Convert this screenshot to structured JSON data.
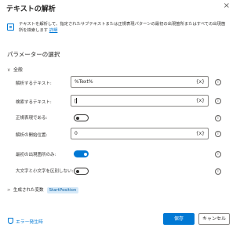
{
  "dialog": {
    "title": "テキストの解析",
    "close_icon": "×"
  },
  "description": {
    "text": "テキストを解析して、指定されたサブテキストまたは正規表現パターンの最初の出現箇所またはすべての出現箇所を検索します",
    "link": "詳細"
  },
  "section_title": "パラメーターの選択",
  "group": {
    "chevron": "∨",
    "label": "全般"
  },
  "fields": {
    "text_to_parse": {
      "label": "解析するテキスト:",
      "value": "%Text%",
      "var_button": "{x}"
    },
    "text_to_find": {
      "label": "検索するテキスト:",
      "value": "[",
      "var_button": "{x}"
    },
    "is_regex": {
      "label": "正規表現である:",
      "enabled": false
    },
    "start_position": {
      "label": "解析の開始位置:",
      "value": "0",
      "var_button": "{x}"
    },
    "first_occurrence_only": {
      "label": "最初の出現箇所のみ:",
      "enabled": true
    },
    "ignore_case": {
      "label": "大文字と小文字を区別しない:",
      "enabled": false
    }
  },
  "info_icon": "i",
  "produced_variables": {
    "chevron": ">",
    "label": "生成された変数",
    "chip": "StartPosition"
  },
  "footer": {
    "error_link": "エラー発生時",
    "save": "保存",
    "cancel": "キャンセル"
  }
}
